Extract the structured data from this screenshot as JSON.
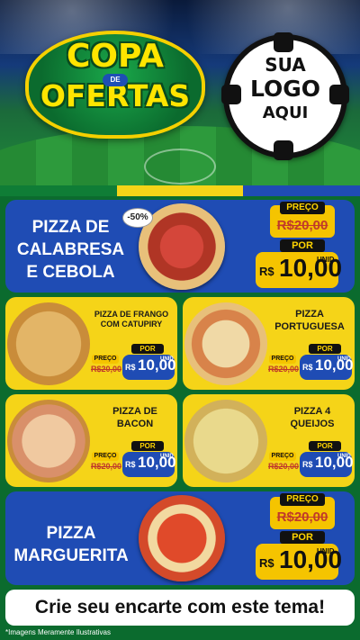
{
  "hero": {
    "title_line1": "COPA",
    "title_de": "DE",
    "title_line2": "OFERTAS",
    "logo_line1": "SUA",
    "logo_line2": "LOGO",
    "logo_line3": "AQUI"
  },
  "colors": {
    "blue": "#1f4cb4",
    "yellow": "#f5d418",
    "green": "#0b6b2e",
    "old_price_red": "#c0392b"
  },
  "discount_badge": "-50%",
  "products": [
    {
      "name": "PIZZA DE CALABRESA E CEBOLA",
      "old_label": "PREÇO",
      "old_price": "R$20,00",
      "new_label": "POR",
      "currency": "R$",
      "price": "10,00",
      "unit": "UNID"
    },
    {
      "name": "PIZZA DE FRANGO COM CATUPIRY",
      "old_label": "PREÇO",
      "old_price": "R$20,00",
      "new_label": "POR",
      "currency": "R$",
      "price": "10,00",
      "unit": "UNID"
    },
    {
      "name": "PIZZA PORTUGUESA",
      "old_label": "PREÇO",
      "old_price": "R$20,00",
      "new_label": "POR",
      "currency": "R$",
      "price": "10,00",
      "unit": "UNID"
    },
    {
      "name": "PIZZA DE BACON",
      "old_label": "PREÇO",
      "old_price": "R$20,00",
      "new_label": "POR",
      "currency": "R$",
      "price": "10,00",
      "unit": "UNID"
    },
    {
      "name": "PIZZA 4 QUEIJOS",
      "old_label": "PREÇO",
      "old_price": "R$20,00",
      "new_label": "POR",
      "currency": "R$",
      "price": "10,00",
      "unit": "UNID"
    },
    {
      "name": "PIZZA MARGUERITA",
      "old_label": "PREÇO",
      "old_price": "R$20,00",
      "new_label": "POR",
      "currency": "R$",
      "price": "10,00",
      "unit": "UNID"
    }
  ],
  "footer": "Crie seu encarte com este tema!",
  "disclaimer": "*Imagens Meramente Ilustrativas"
}
